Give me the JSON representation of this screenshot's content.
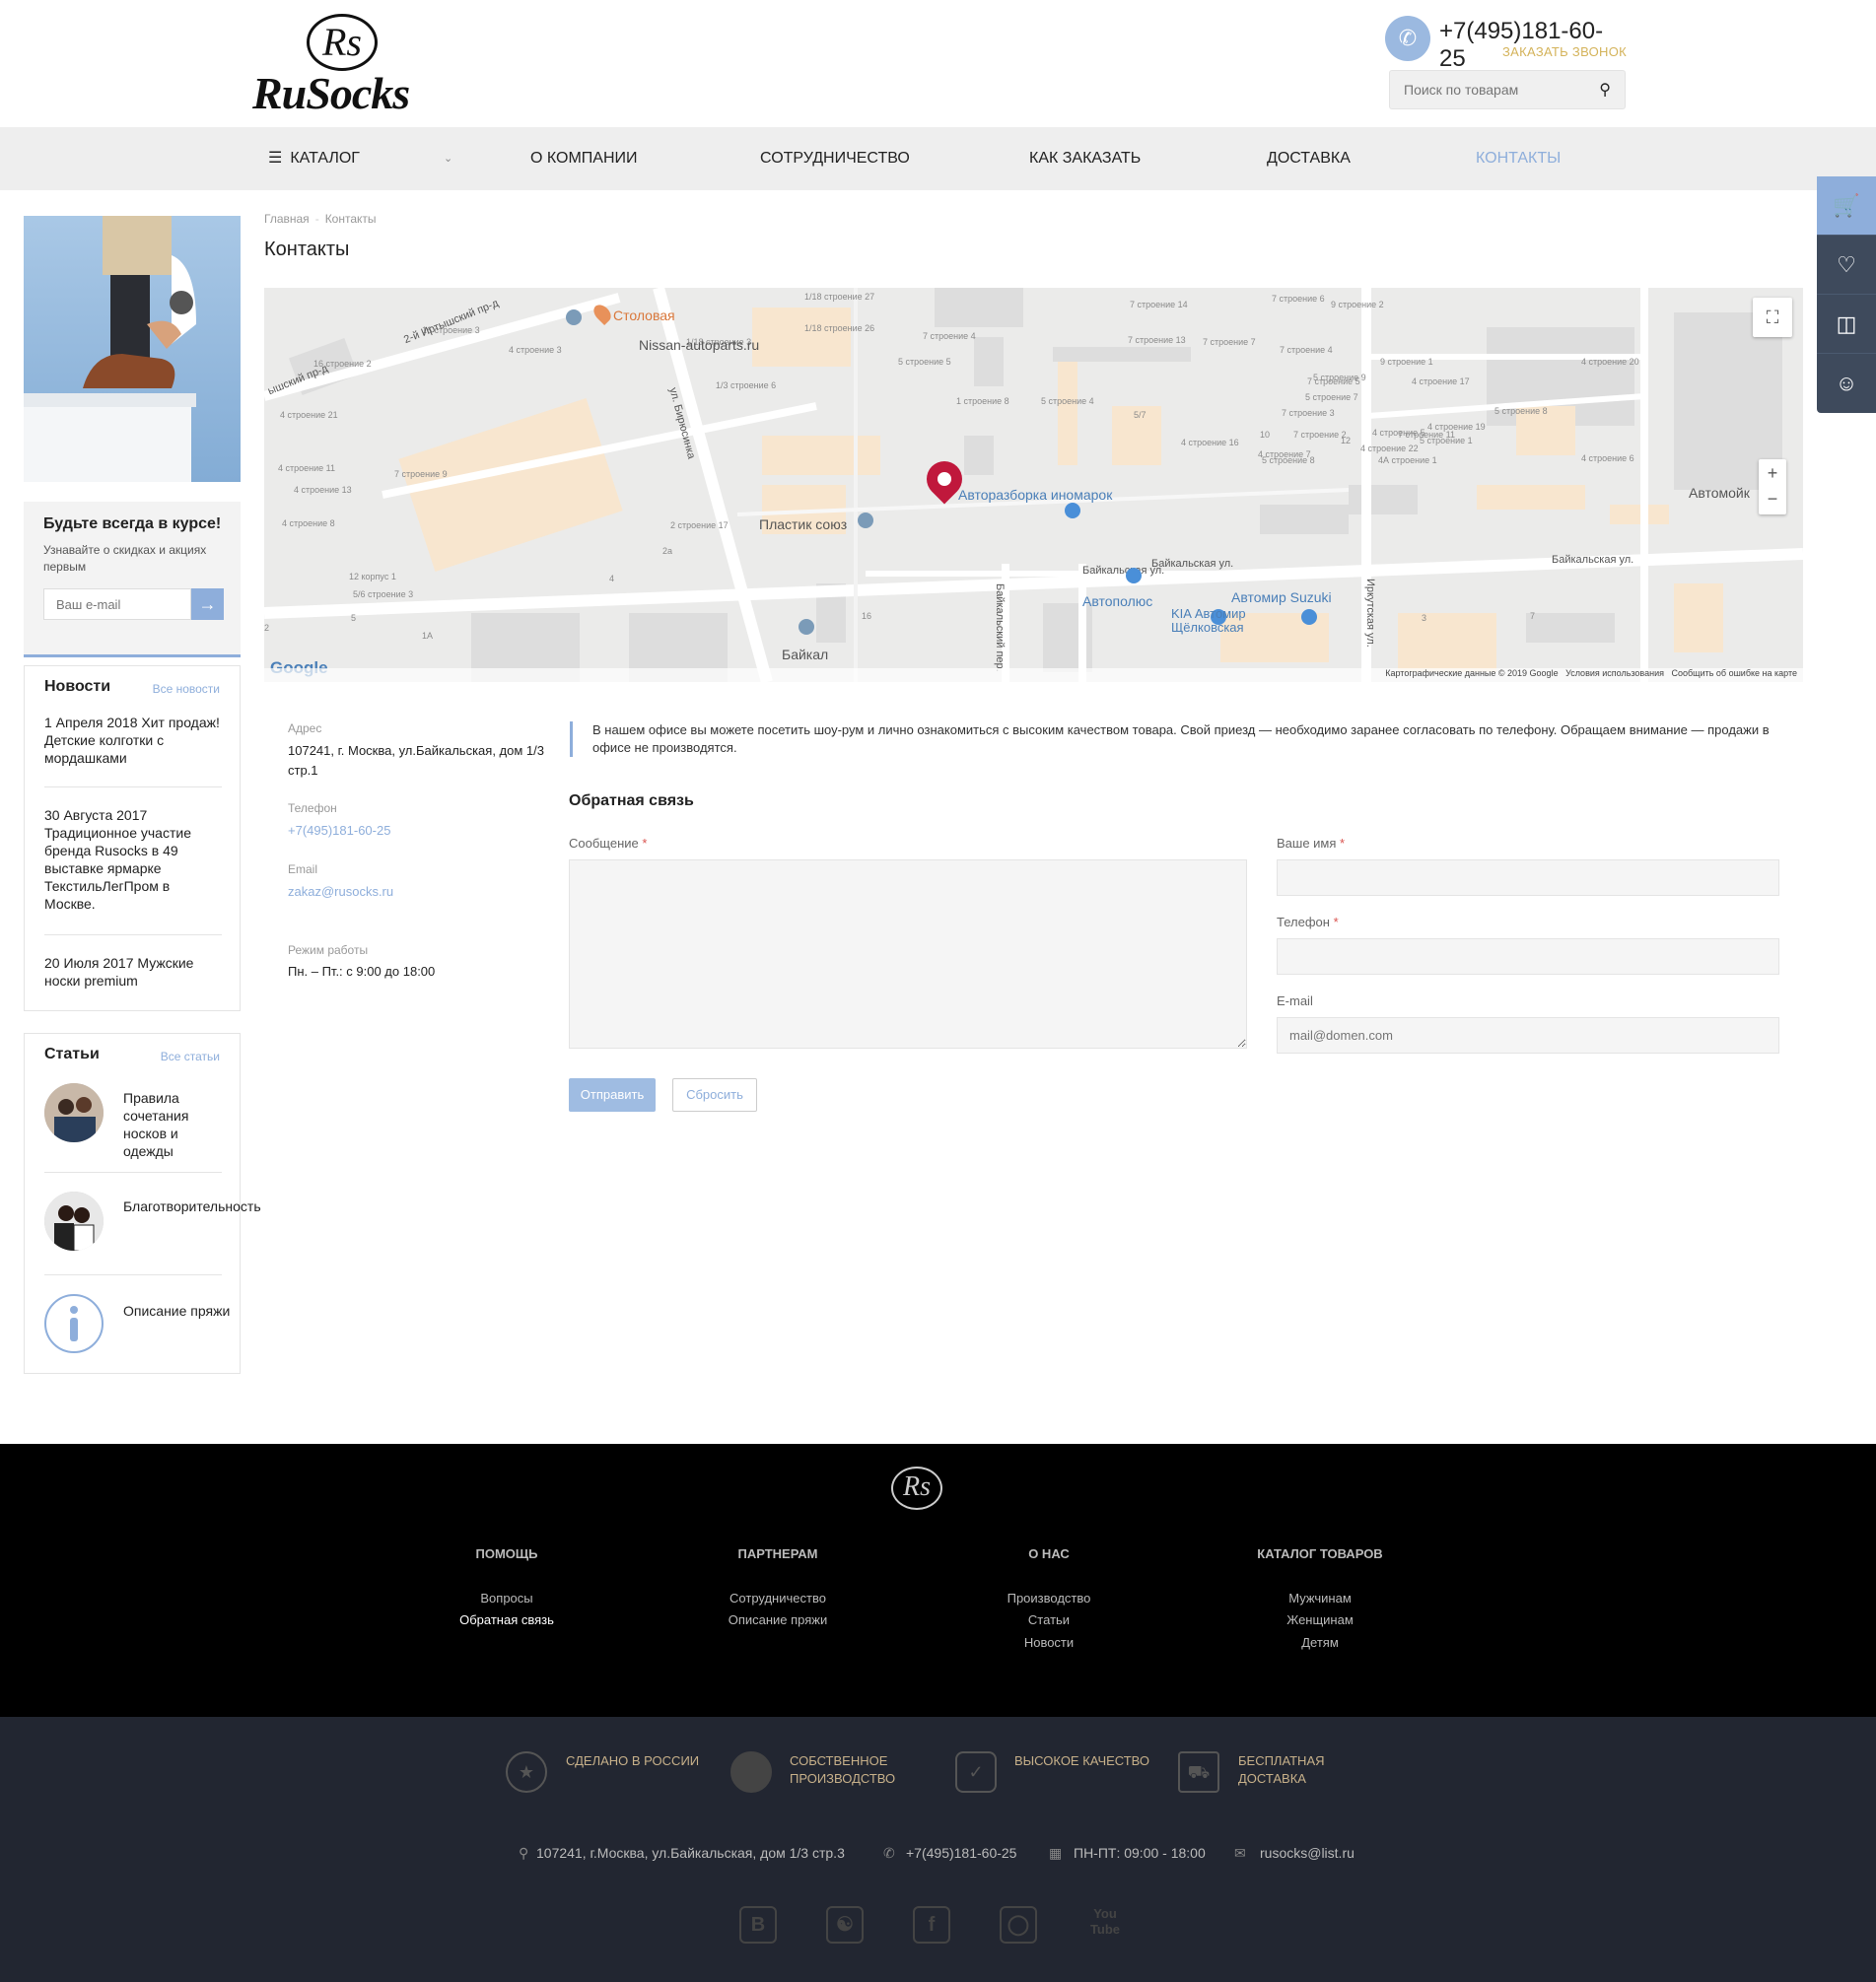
{
  "header": {
    "logo_mono": "Rs",
    "logo_word": "RuSocks",
    "phone": "+7(495)181-60-25",
    "callback": "ЗАКАЗАТЬ ЗВОНОК",
    "search_placeholder": "Поиск по товарам"
  },
  "nav": {
    "items": [
      {
        "label": "КАТАЛОГ"
      },
      {
        "label": "О КОМПАНИИ"
      },
      {
        "label": "СОТРУДНИЧЕСТВО"
      },
      {
        "label": "КАК ЗАКАЗАТЬ"
      },
      {
        "label": "ДОСТАВКА"
      },
      {
        "label": "КОНТАКТЫ"
      }
    ]
  },
  "sidebar": {
    "subscribe": {
      "title": "Будьте всегда в курсе!",
      "text": "Узнавайте о скидках и акциях первым",
      "placeholder": "Ваш e-mail"
    },
    "news": {
      "title": "Новости",
      "all": "Все новости",
      "items": [
        {
          "text": "1 Апреля 2018 Хит продаж! Детские колготки с мордашками"
        },
        {
          "text": "30 Августа 2017 Традиционное участие бренда Rusocks в 49 выставке ярмарке ТекстильЛегПром в Москве."
        },
        {
          "text": "20 Июля 2017 Мужские носки premium"
        }
      ]
    },
    "articles": {
      "title": "Статьи",
      "all": "Все статьи",
      "items": [
        {
          "text": "Правила сочетания носков и одежды"
        },
        {
          "text": "Благотворительность"
        },
        {
          "text": "Описание пряжи"
        }
      ]
    }
  },
  "breadcrumb": {
    "home": "Главная",
    "sep": "-",
    "current": "Контакты"
  },
  "page_title": "Контакты",
  "map": {
    "places": {
      "stolovaya": "Столовая",
      "nissan": "Nissan-autoparts.ru",
      "razborka": "Авторазборка иномарок",
      "plastik": "Пластик союз",
      "avtopolus": "Автополюс",
      "suzuki": "Автомир Suzuki",
      "kia": "KIA Автомир Щёлковская",
      "baikal": "Байкал",
      "avtomoyka": "Автомойк"
    },
    "streets": {
      "baikalskaya1": "Байкальская ул.",
      "baikalskaya2": "Байкальская ул.",
      "baikalskaya3": "Байкальская ул.",
      "birusinka": "ул. Бирюсинка",
      "baikalskiy_per": "Байкальский пер.",
      "irkutskaya": "Иркутская ул.",
      "irtysh": "2-й Иртышский пр-д",
      "irtysh2": "ышский пр-д"
    },
    "buildings": [
      "16 строение 3",
      "4 строение 3",
      "1/18 строение 3",
      "1/18 строение 27",
      "1/18 строение 26",
      "7 строение 4",
      "5 строение 5",
      "7 строение 14",
      "7 строение 6",
      "9 строение 2",
      "7 строение 13",
      "7 строение 7",
      "7 строение 4",
      "9 строение 1",
      "16 строение 2",
      "1/3 строение 6",
      "1 строение 8",
      "5 строение 4",
      "5/7",
      "5 строение 9",
      "5 строение 7",
      "7 строение 5",
      "4 строение 21",
      "7 строение 3",
      "7 строение 11",
      "7 строение 2",
      "4 строение 5",
      "7 строение 9",
      "4 строение 11",
      "4 строение 19",
      "5 строение 1",
      "5 строение 8",
      "4 строение 22",
      "4А строение 1",
      "4 строение 6",
      "4 строение 20",
      "4 строение 17",
      "4 строение 16",
      "4 строение 7",
      "4 строение 13",
      "5 строение 8",
      "2 строение 17",
      "12 корпус 1",
      "4 строение 8",
      "5/6 строение 3",
      "10",
      "12",
      "2а",
      "4",
      "5",
      "2",
      "1А",
      "16",
      "3",
      "7"
    ],
    "copyright": "Картографические данные © 2019 Google",
    "terms": "Условия использования",
    "report": "Сообщить об ошибке на карте",
    "google": "Google"
  },
  "contacts": {
    "address_label": "Адрес",
    "address": "107241, г. Москва, ул.Байкальская, дом 1/3 стр.1",
    "phone_label": "Телефон",
    "phone": "+7(495)181-60-25",
    "email_label": "Email",
    "email": "zakaz@rusocks.ru",
    "hours_label": "Режим работы",
    "hours": "Пн. – Пт.: с 9:00 до 18:00"
  },
  "notice": "В нашем офисе вы можете посетить шоу-рум и лично ознакомиться с высоким качеством товара. Свой приезд — необходимо заранее согласовать по телефону. Обращаем внимание — продажи в офисе не производятся.",
  "form": {
    "title": "Обратная связь",
    "message_label": "Сообщение",
    "name_label": "Ваше имя",
    "phone_label": "Телефон",
    "email_label": "E-mail",
    "email_placeholder": "mail@domen.com",
    "required": "*",
    "send": "Отправить",
    "reset": "Сбросить"
  },
  "footer": {
    "logo": "Rs",
    "columns": [
      {
        "title": "ПОМОЩЬ",
        "links": [
          "Вопросы",
          "Обратная связь"
        ]
      },
      {
        "title": "ПАРТНЕРАМ",
        "links": [
          "Сотрудничество",
          "Описание пряжи"
        ]
      },
      {
        "title": "О НАС",
        "links": [
          "Производство",
          "Статьи",
          "Новости"
        ]
      },
      {
        "title": "КАТАЛОГ ТОВАРОВ",
        "links": [
          "Мужчинам",
          "Женщинам",
          "Детям"
        ]
      }
    ],
    "features": [
      {
        "text": "СДЕЛАНО В РОССИИ"
      },
      {
        "text": "СОБСТВЕННОЕ ПРОИЗВОДСТВО"
      },
      {
        "text": "ВЫСОКОЕ КАЧЕСТВО"
      },
      {
        "text": "БЕСПЛАТНАЯ ДОСТАВКА"
      }
    ],
    "address": "107241, г.Москва, ул.Байкальская, дом 1/3 стр.3",
    "phone": "+7(495)181-60-25",
    "hours": "ПН-ПТ: 09:00 - 18:00",
    "email": "rusocks@list.ru",
    "social": [
      "vk-icon",
      "odnoklassniki-icon",
      "facebook-icon",
      "instagram-icon",
      "youtube-icon"
    ]
  },
  "colors": {
    "accent": "#8eaedb",
    "gold": "#d4b35a",
    "pin": "#c0183c",
    "footer_top": "#000000",
    "footer_bottom": "#222631"
  }
}
